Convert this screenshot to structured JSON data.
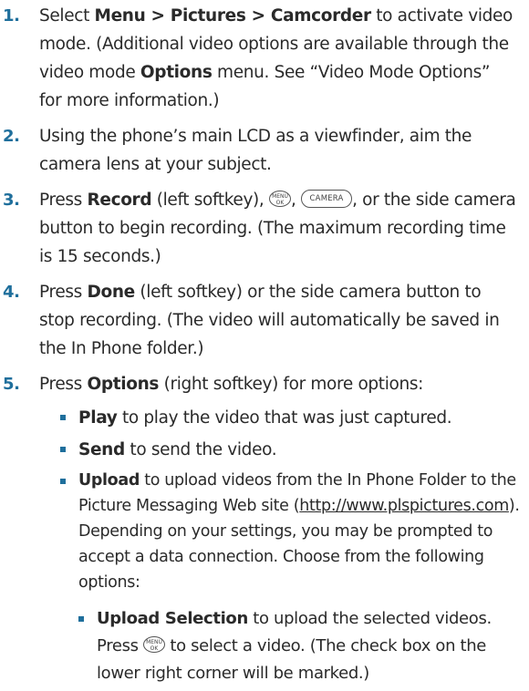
{
  "steps": [
    {
      "num": "1.",
      "pre": "Select ",
      "bold1": "Menu > Pictures > Camcorder",
      "mid": " to activate video mode. (Additional video options are available through the video mode ",
      "bold2": "Options",
      "post": " menu. See “Video Mode Options” for more information.)"
    },
    {
      "num": "2.",
      "text": "Using the phone’s main LCD as a viewfinder, aim the camera lens at your subject."
    },
    {
      "num": "3.",
      "pre": "Press ",
      "bold1": "Record",
      "mid": " (left softkey), ",
      "sep": ", ",
      "post": ", or the side camera button to begin recording. (The maximum recording time is 15 seconds.)"
    },
    {
      "num": "4.",
      "pre": "Press ",
      "bold1": "Done",
      "post": " (left softkey) or the side camera button to stop recording. (The video will automatically be saved in the In Phone folder.)"
    },
    {
      "num": "5.",
      "pre": "Press ",
      "bold1": "Options",
      "post": " (right softkey) for more options:"
    }
  ],
  "options": [
    {
      "bold": "Play",
      "text": " to play the video that was just captured."
    },
    {
      "bold": "Send",
      "text": " to send the video."
    },
    {
      "bold": "Upload",
      "pre": " to upload videos from the In Phone Folder to the Picture Messaging  Web site (",
      "link": "http://www.plspictures.com",
      "post": "). Depending on your settings, you may be prompted to accept a data connection. Choose from the following options:"
    }
  ],
  "suboptions": [
    {
      "bold": "Upload Selection",
      "pre": " to upload the selected videos. Press ",
      "post": " to select a video. (The check box on the lower right corner will be marked.)"
    }
  ],
  "icons": {
    "menu_ok_line1": "MENU",
    "menu_ok_line2": "OK",
    "camera_key": "CAMERA"
  },
  "colors": {
    "accent": "#1f6f9c",
    "text": "#2a2a2a"
  }
}
